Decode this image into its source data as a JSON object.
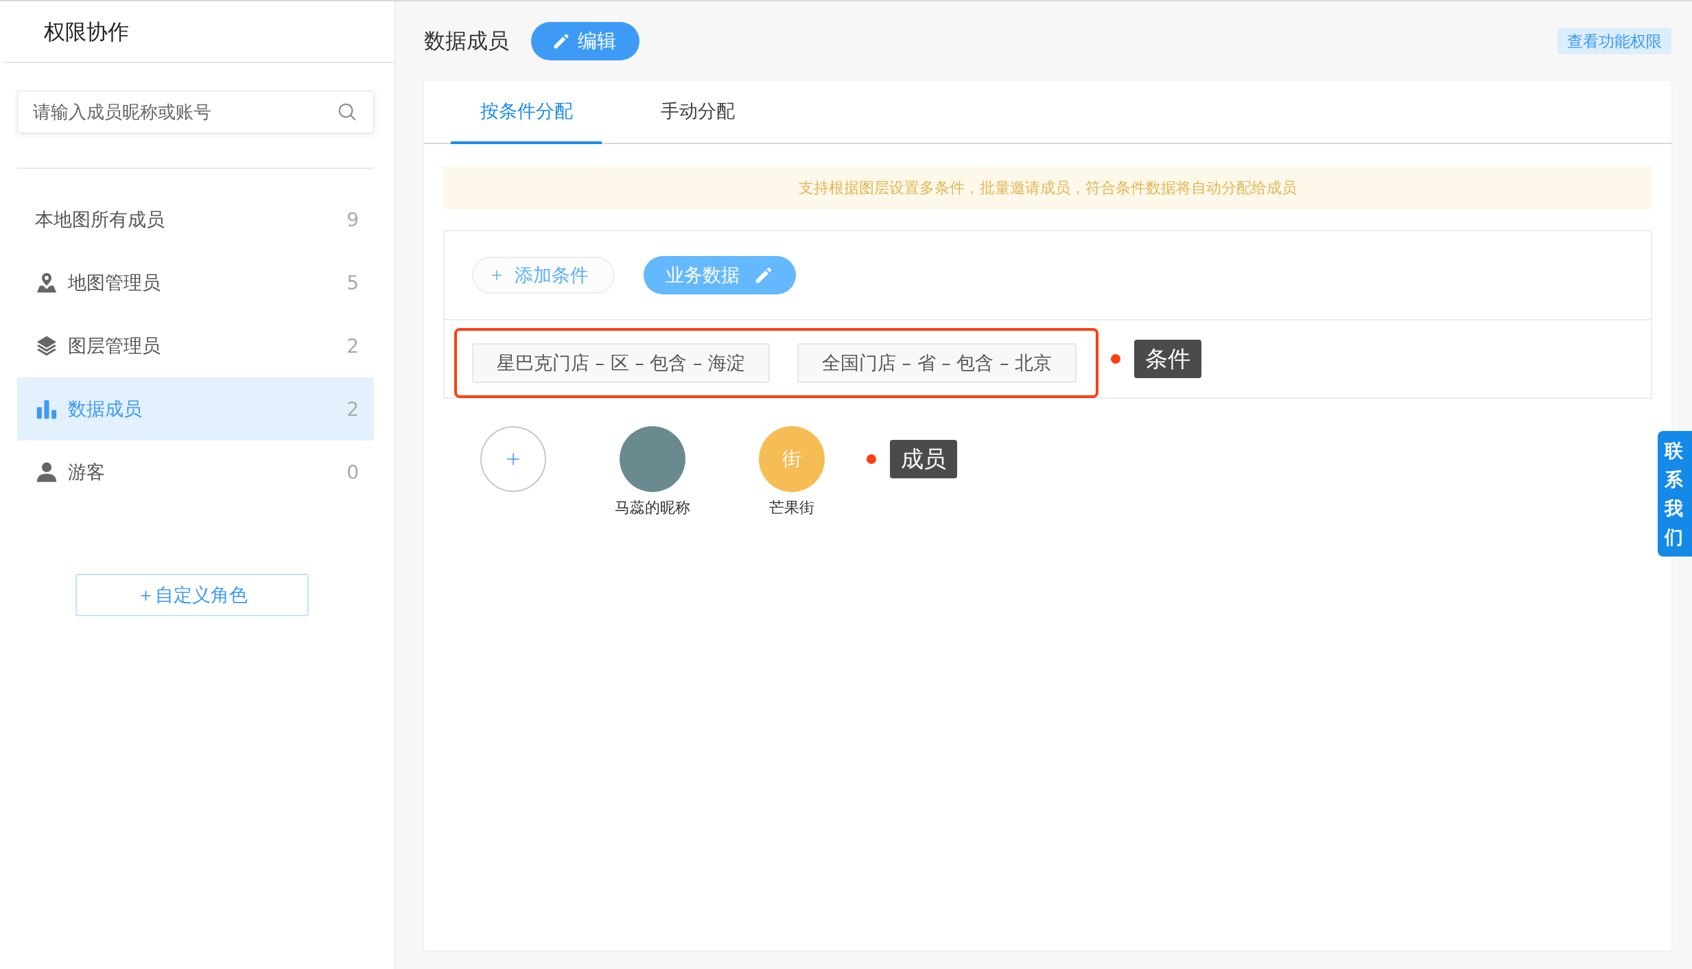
{
  "sidebar": {
    "title": "权限协作",
    "search": {
      "placeholder": "请输入成员昵称或账号"
    },
    "items": [
      {
        "label": "本地图所有成员",
        "count": "9",
        "kind": "all",
        "selected": false
      },
      {
        "label": "地图管理员",
        "count": "5",
        "kind": "map",
        "selected": false
      },
      {
        "label": "图层管理员",
        "count": "2",
        "kind": "layer",
        "selected": false
      },
      {
        "label": "数据成员",
        "count": "2",
        "kind": "data",
        "selected": true
      },
      {
        "label": "游客",
        "count": "0",
        "kind": "guest",
        "selected": false
      }
    ],
    "add_role_button": "＋自定义角色"
  },
  "header": {
    "title": "数据成员",
    "edit_button": "编辑",
    "permissions_button": "查看功能权限"
  },
  "tabs": [
    {
      "label": "按条件分配",
      "selected": true
    },
    {
      "label": "手动分配",
      "selected": false
    }
  ],
  "notice": "支持根据图层设置多条件，批量邀请成员，符合条件数据将自动分配给成员",
  "toolbar": {
    "add_condition_button": "添加条件",
    "business_data_button": "业务数据"
  },
  "conditions": [
    "星巴克门店 – 区 – 包含 – 海淀",
    "全国门店 – 省 – 包含 – 北京"
  ],
  "condition_annotation": "条件",
  "members": [
    {
      "name": "马蕊的昵称",
      "kind": "photo"
    },
    {
      "name": "芒果街",
      "kind": "initial",
      "initial": "街",
      "color": "#f5bd53"
    }
  ],
  "member_annotation": "成员",
  "contact_tab": "联系我们"
}
